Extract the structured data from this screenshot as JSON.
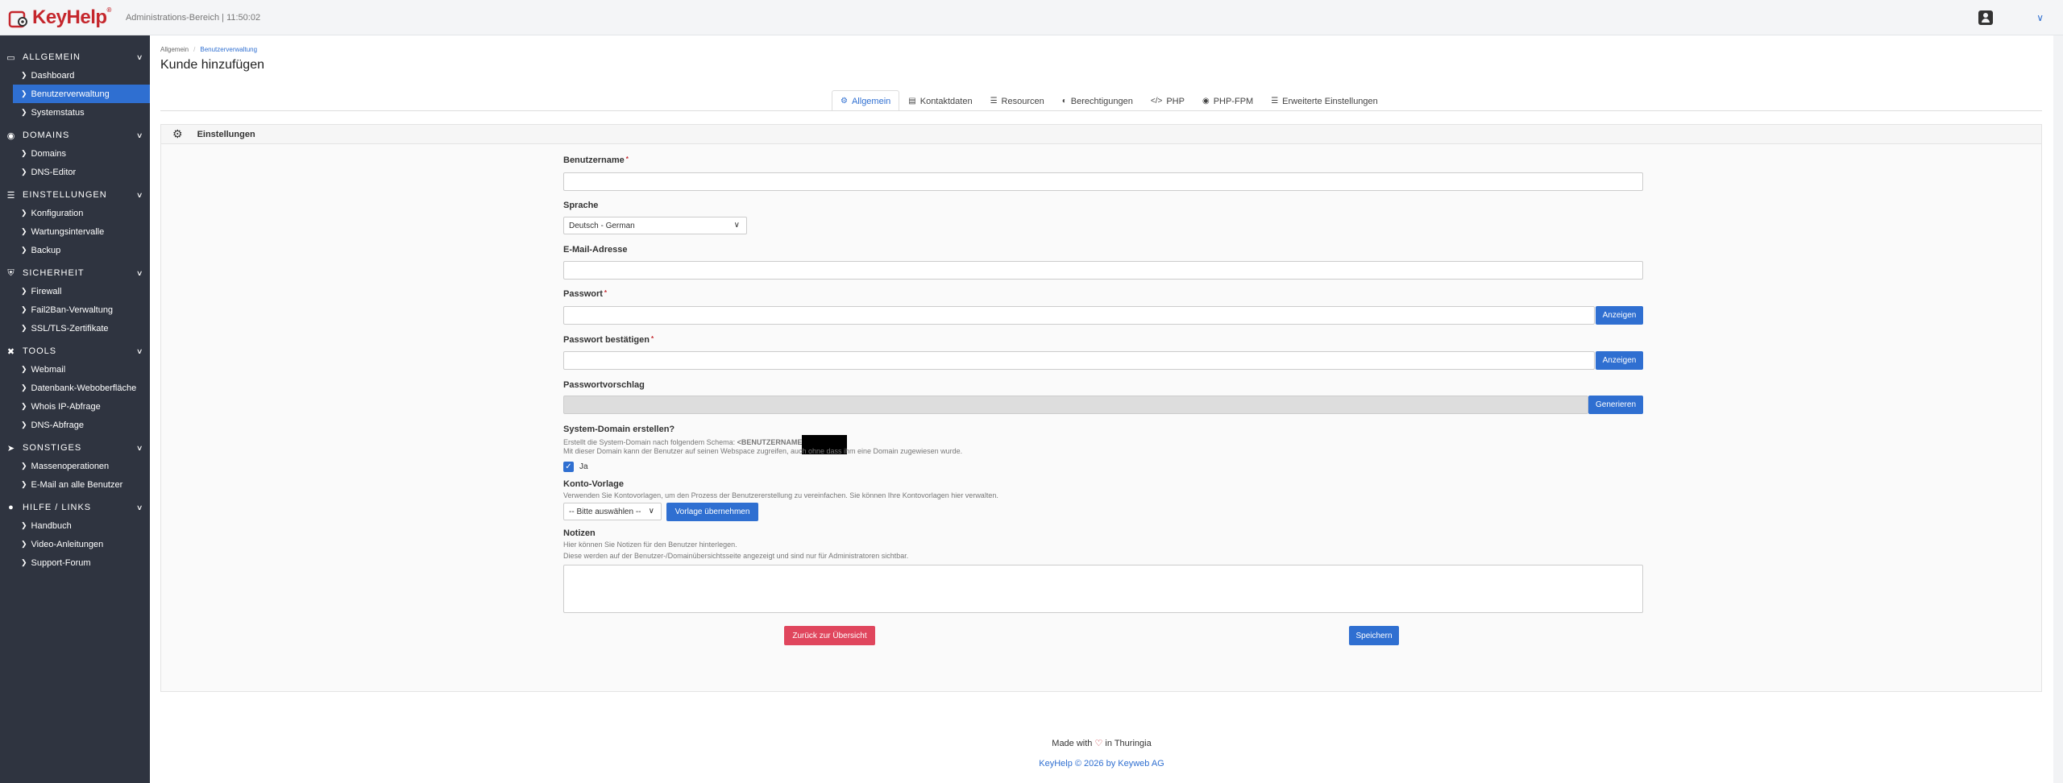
{
  "topbar": {
    "logo_text": "KeyHelp",
    "info": "Administrations-Bereich | 11:50:02"
  },
  "sidebar": {
    "sections": [
      {
        "label": "ALLGEMEIN",
        "icon": "monitor-icon",
        "items": [
          "Dashboard",
          "Benutzerverwaltung",
          "Systemstatus"
        ]
      },
      {
        "label": "DOMAINS",
        "icon": "globe-icon",
        "items": [
          "Domains",
          "DNS-Editor"
        ]
      },
      {
        "label": "EINSTELLUNGEN",
        "icon": "sliders-icon",
        "items": [
          "Konfiguration",
          "Wartungsintervalle",
          "Backup"
        ]
      },
      {
        "label": "SICHERHEIT",
        "icon": "shield-icon",
        "items": [
          "Firewall",
          "Fail2Ban-Verwaltung",
          "SSL/TLS-Zertifikate"
        ]
      },
      {
        "label": "TOOLS",
        "icon": "tools-icon",
        "items": [
          "Webmail",
          "Datenbank-Weboberfläche",
          "Whois IP-Abfrage",
          "DNS-Abfrage"
        ]
      },
      {
        "label": "SONSTIGES",
        "icon": "rocket-icon",
        "items": [
          "Massenoperationen",
          "E-Mail an alle Benutzer"
        ]
      },
      {
        "label": "HILFE / LINKS",
        "icon": "help-icon",
        "items": [
          "Handbuch",
          "Video-Anleitungen",
          "Support-Forum"
        ]
      }
    ],
    "active_item": "Benutzerverwaltung"
  },
  "breadcrumb": {
    "home": "Allgemein",
    "current": "Benutzerverwaltung"
  },
  "page_title": "Kunde hinzufügen",
  "tabs": [
    {
      "label": "Allgemein",
      "icon": "gear-icon",
      "active": true
    },
    {
      "label": "Kontaktdaten",
      "icon": "id-card-icon"
    },
    {
      "label": "Resourcen",
      "icon": "list-icon"
    },
    {
      "label": "Berechtigungen",
      "icon": "toggle-icon"
    },
    {
      "label": "PHP",
      "icon": "code-icon"
    },
    {
      "label": "PHP-FPM",
      "icon": "cog-circle-icon"
    },
    {
      "label": "Erweiterte Einstellungen",
      "icon": "list-alt-icon"
    }
  ],
  "card": {
    "title": "Einstellungen"
  },
  "form": {
    "username_label": "Benutzername",
    "language_label": "Sprache",
    "language_value": "Deutsch - German",
    "email_label": "E-Mail-Adresse",
    "password_label": "Passwort",
    "password_button": "Anzeigen",
    "password_confirm_label": "Passwort bestätigen",
    "password_confirm_button": "Anzeigen",
    "password_suggestion_label": "Passwortvorschlag",
    "generate_button": "Generieren",
    "system_domain_label": "System-Domain erstellen?",
    "system_domain_help1": "Erstellt die System-Domain nach folgendem Schema: ",
    "system_domain_scheme": "<BENUTZERNAME",
    "system_domain_help2": "Mit dieser Domain kann der Benutzer auf seinen Webspace zugreifen, auch ohne dass ihm eine Domain zugewiesen wurde.",
    "system_domain_check_label": "Ja",
    "template_label": "Konto-Vorlage",
    "template_help": "Verwenden Sie Kontovorlagen, um den Prozess der Benutzererstellung zu vereinfachen. Sie können Ihre Kontovorlagen hier verwalten.",
    "template_select": "-- Bitte auswählen --",
    "template_button": "Vorlage übernehmen",
    "notes_label": "Notizen",
    "notes_help1": "Hier können Sie Notizen für den Benutzer hinterlegen.",
    "notes_help2": "Diese werden auf der Benutzer-/Domainübersichtsseite angezeigt und sind nur für Administratoren sichtbar.",
    "back_button": "Zurück zur Übersicht",
    "save_button": "Speichern"
  },
  "footer": {
    "made_with": "Made with",
    "in_place": "in Thuringia",
    "copyright": "KeyHelp © 2026 by Keyweb AG"
  },
  "colors": {
    "accent": "#2f6fd1",
    "brand": "#c5272d",
    "sidebar_bg": "#2f3440",
    "danger": "#e0465d"
  }
}
